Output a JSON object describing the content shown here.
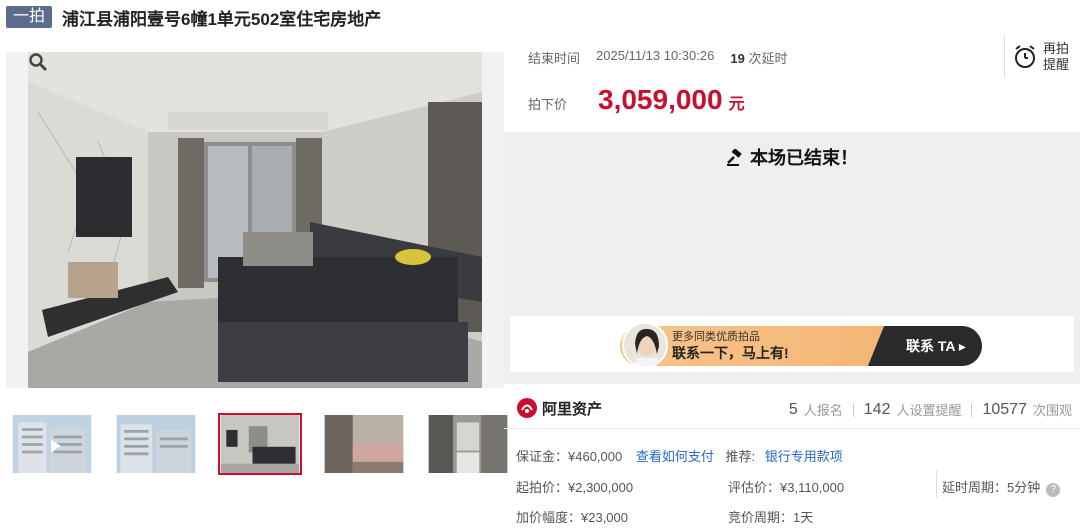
{
  "header": {
    "badge": "一拍",
    "title": "浦江县浦阳壹号6幢1单元502室住宅房地产"
  },
  "auction": {
    "end_label": "结束时间",
    "end_time": "2025/11/13 10:30:26",
    "delay_count": "19",
    "delay_label": "次延时",
    "price_label": "拍下价",
    "price_value": "3,059,000",
    "price_unit": "元",
    "remind_line1": "再拍",
    "remind_line2": "提醒",
    "ended_text": "本场已结束！"
  },
  "banner": {
    "sub": "更多同类优质拍品",
    "main": "联系一下，马上有!",
    "cta": "联系 TA ▸"
  },
  "stats": {
    "logo_text": "阿里资产",
    "signups": "5",
    "signups_label": "人报名",
    "reminders": "142",
    "reminders_label": "人设置提醒",
    "views": "10577",
    "views_label": "次围观"
  },
  "details": {
    "deposit": "保证金：¥460,000",
    "pay_link": "查看如何支付",
    "recommend_label": "推荐:",
    "recommend_link": "银行专用款项",
    "start_price": "起拍价：¥2,300,000",
    "appraisal": "评估价：¥3,110,000",
    "delay_period": "延时周期：5分钟",
    "increment": "加价幅度：¥23,000",
    "bid_period": "竞价周期：1天"
  },
  "colors": {
    "accent_red": "#c8102e",
    "link_blue": "#2468c9",
    "badge_bg": "#5a6b8c"
  }
}
